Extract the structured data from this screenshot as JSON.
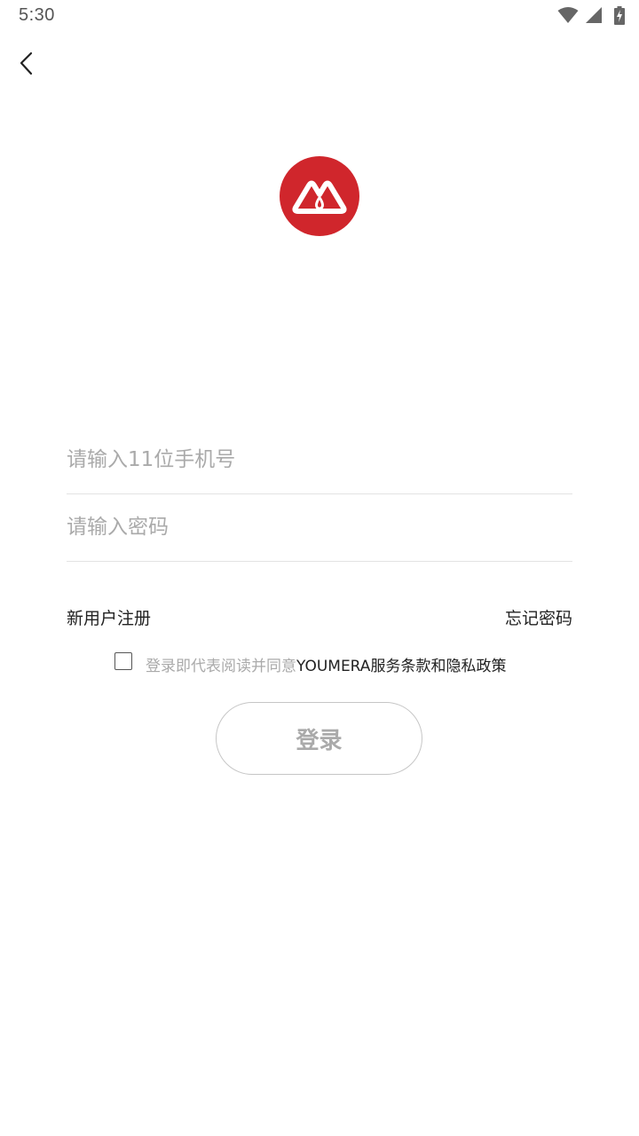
{
  "status_bar": {
    "time": "5:30",
    "icons": [
      "wifi-icon",
      "signal-icon",
      "battery-charging-icon"
    ]
  },
  "nav": {
    "back_icon": "chevron-left-icon"
  },
  "logo": {
    "icon": "youmera-logo",
    "color": "#d0262c"
  },
  "form": {
    "phone_placeholder": "请输入11位手机号",
    "phone_value": "",
    "password_placeholder": "请输入密码",
    "password_value": ""
  },
  "links": {
    "register": "新用户注册",
    "forgot_password": "忘记密码"
  },
  "agreement": {
    "checked": false,
    "prefix": "登录即代表阅读并同意",
    "link": "YOUMERA服务条款和隐私政策"
  },
  "login_button": {
    "label": "登录"
  }
}
